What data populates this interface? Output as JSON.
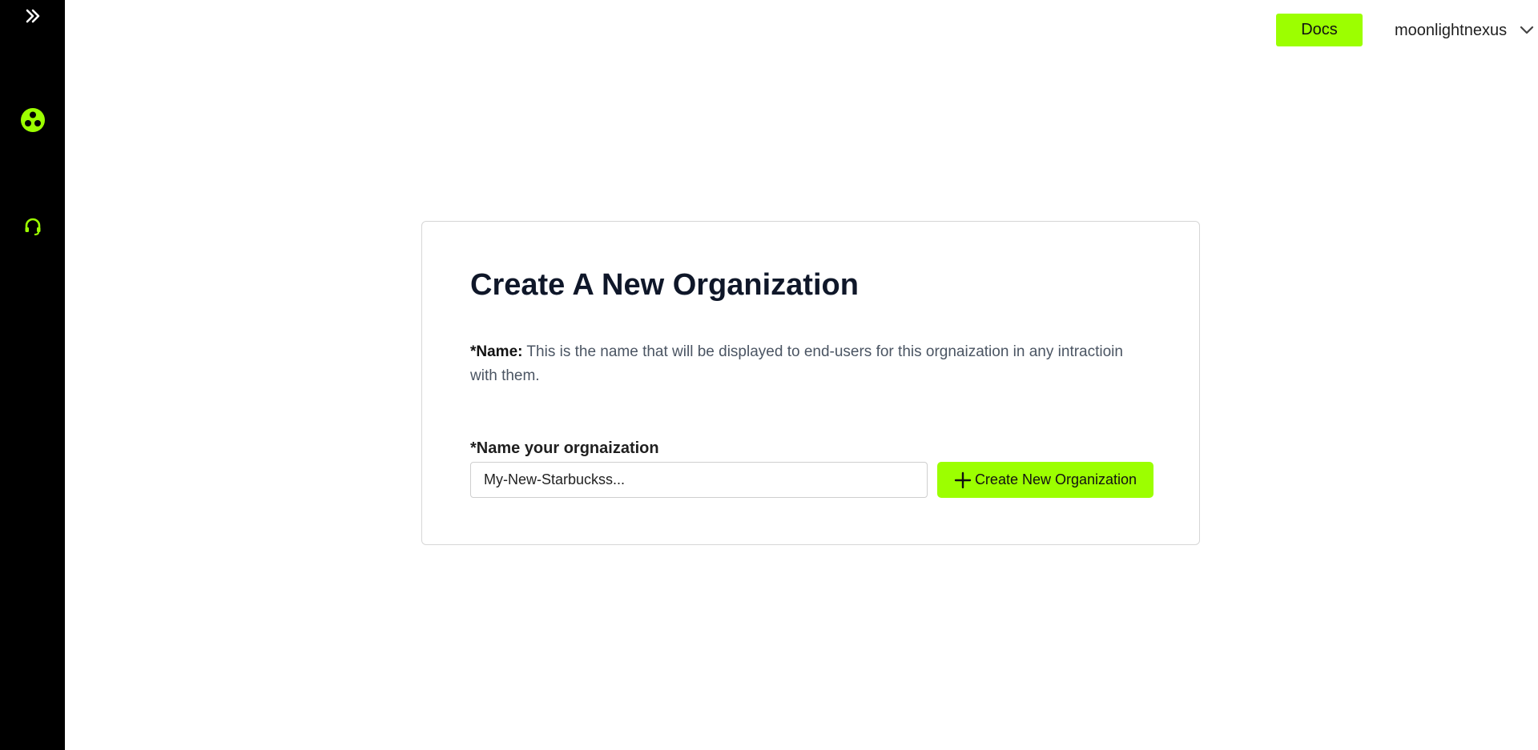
{
  "sidebar": {
    "items": [
      {
        "name": "expand",
        "icon": "double-chevron-right-icon"
      },
      {
        "name": "organizations",
        "icon": "three-dots-circle-icon"
      },
      {
        "name": "support",
        "icon": "headset-icon"
      }
    ]
  },
  "header": {
    "docs_label": "Docs",
    "username": "moonlightnexus",
    "avatar_icon": "user-avatar"
  },
  "main": {
    "title": "Create A New Organization",
    "description_label": "*Name:",
    "description_text": " This is the name that will be displayed to end-users for this orgnaization in any intractioin with them.",
    "field_label": "*Name your orgnaization",
    "input_value": "My-New-Starbuckss...",
    "create_button_label": "Create New Organization"
  },
  "colors": {
    "accent": "#9cff00",
    "sidebar_bg": "#000000",
    "title": "#0f1729"
  }
}
